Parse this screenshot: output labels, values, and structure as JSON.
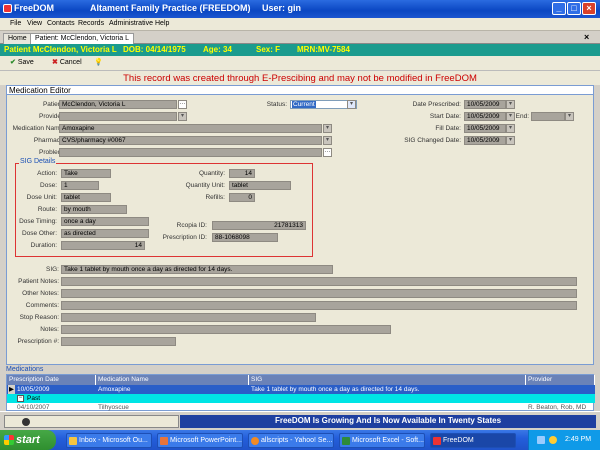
{
  "window": {
    "app": "FreeDOM",
    "title": "Altament Family Practice  (FREEDOM)",
    "user": "User: gin"
  },
  "menu": [
    "File",
    "View",
    "Contacts",
    "Records",
    "Administrative",
    "Help"
  ],
  "tabs": [
    "Home",
    "Patient: McClendon, Victoria L"
  ],
  "patient": {
    "name": "Patient McClendon, Victoria L",
    "dob": "DOB: 04/14/1975",
    "age": "Age: 34",
    "sex": "Sex: F",
    "mrn": "MRN:MV-7584"
  },
  "toolbar": {
    "save": "Save",
    "cancel": "Cancel"
  },
  "notice": "This record was created through E-Prescibing and may not be modified in FreeDOM",
  "editor_title": "Medication Editor",
  "form": {
    "patient_label": "Patient:",
    "patient": "McClendon, Victoria L",
    "provider_label": "Provider:",
    "medname_label": "Medication Name:",
    "medname": "Amoxapine",
    "pharmacy_label": "Pharmacy:",
    "pharmacy": "CVS/pharmacy #0067",
    "problem_label": "Problem:",
    "status_label": "Status:",
    "status": "Current",
    "dateprescribed_label": "Date Prescribed:",
    "dateprescribed": "10/05/2009",
    "startdate_label": "Start Date:",
    "startdate": "10/05/2009",
    "end_label": "End:",
    "filldate_label": "Fill Date:",
    "filldate": "10/05/2009",
    "sigchanged_label": "SIG Changed Date:",
    "sigchanged": "10/05/2009"
  },
  "sig": {
    "title": "SIG Details",
    "action_label": "Action:",
    "action": "Take",
    "dose_label": "Dose:",
    "dose": "1",
    "doseunit_label": "Dose Unit:",
    "doseunit": "tablet",
    "route_label": "Route:",
    "route": "by mouth",
    "dosetiming_label": "Dose Timing:",
    "dosetiming": "once a day",
    "doseother_label": "Dose Other:",
    "doseother": "as directed",
    "duration_label": "Duration:",
    "duration": "14",
    "quantity_label": "Quantity:",
    "quantity": "14",
    "quantityunit_label": "Quantity Unit:",
    "quantityunit": "tablet",
    "refills_label": "Refills:",
    "refills": "0",
    "rcopia_label": "Rcopia ID:",
    "rcopia": "21781313",
    "prescription_label": "Prescription ID:",
    "prescription": "88-1068098"
  },
  "notes": {
    "sig_label": "SIG:",
    "sig": "Take 1 tablet by mouth once a day as directed for 14 days.",
    "patientnotes_label": "Patient Notes:",
    "othernotes_label": "Other Notes:",
    "comments_label": "Comments:",
    "stopreason_label": "Stop Reason:",
    "notes_label": "Notes:",
    "prescriptionnum_label": "Prescription #:"
  },
  "medications": {
    "title": "Medications",
    "headers": [
      "Prescription Date",
      "Medication Name",
      "SIG",
      "Provider"
    ],
    "row1": {
      "date": "10/05/2009",
      "name": "Amoxapine",
      "sig": "Take 1 tablet by mouth once a day as directed for 14 days."
    },
    "group": "Past",
    "row2": {
      "date": "04/10/2007",
      "name": "Tilhyoscue",
      "provider": "R. Beaton, Rob, MD"
    }
  },
  "statusbar": {
    "message": "FreeDOM Is Growing And Is Now Available In Twenty States"
  },
  "taskbar": {
    "start": "start",
    "tasks": [
      "Inbox - Microsoft Ou...",
      "Microsoft PowerPoint...",
      "allscripts - Yahoo! Se...",
      "Microsoft Excel - Soft...",
      "FreeDOM"
    ],
    "time": "2:49 PM"
  },
  "colors": {
    "accent": "#1b9b8e",
    "notice": "#cc0000",
    "grid_selected": "#2a5ec8",
    "grid_group": "#00e5e5",
    "statusbar": "#1e3fa0"
  }
}
